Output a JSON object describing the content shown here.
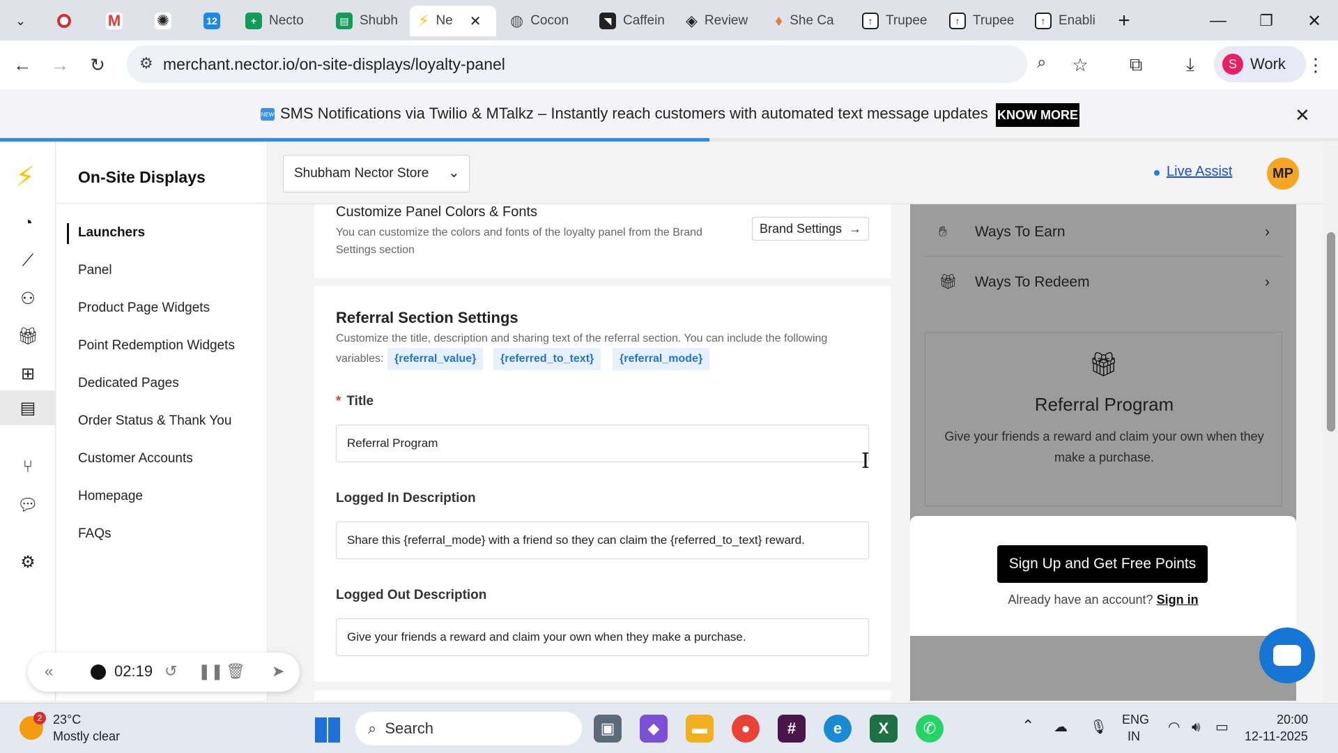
{
  "browser": {
    "tabs": [
      {
        "label": "",
        "icon": "chevron-down-icon",
        "color": "#dfe3e9"
      },
      {
        "label": "",
        "icon": "record-icon",
        "color": "#d32f2f"
      },
      {
        "label": "",
        "icon": "gmail-icon",
        "color": "#e53935"
      },
      {
        "label": "",
        "icon": "openai-icon",
        "color": "#222222"
      },
      {
        "label": "",
        "icon": "calendar-icon",
        "color": "#1e88e5"
      },
      {
        "label": "Necto",
        "icon": "sheets-icon",
        "color": "#0f9d58"
      },
      {
        "label": "Shubh",
        "icon": "sheets-icon",
        "color": "#0f9d58"
      },
      {
        "label": "Ne",
        "icon": "nector-icon",
        "color": "#ffc400",
        "active": true
      },
      {
        "label": "Cocon",
        "icon": "globe-icon",
        "color": "#555555"
      },
      {
        "label": "Caffein",
        "icon": "caffeine-icon",
        "color": "#222222"
      },
      {
        "label": "Review",
        "icon": "review-icon",
        "color": "#222222"
      },
      {
        "label": "She Ca",
        "icon": "drop-icon",
        "color": "#e57c3a"
      },
      {
        "label": "Trupee",
        "icon": "trupee-icon",
        "color": "#222222"
      },
      {
        "label": "Trupee",
        "icon": "trupee-icon",
        "color": "#222222"
      },
      {
        "label": "Enabli",
        "icon": "trupee-icon",
        "color": "#222222"
      }
    ],
    "url": "merchant.nector.io/on-site-displays/loyalty-panel",
    "profile_label": "Work",
    "profile_initial": "S"
  },
  "banner": {
    "text": "SMS Notifications via Twilio & MTalkz – Instantly reach customers with automated text message updates",
    "button": "KNOW MORE",
    "icon_text": "NEW",
    "progress": 0.53
  },
  "sidebar": {
    "title": "On-Site Displays",
    "items": [
      "Launchers",
      "Panel",
      "Product Page Widgets",
      "Point Redemption Widgets",
      "Dedicated Pages",
      "Order Status & Thank You",
      "Customer Accounts",
      "Homepage",
      "FAQs"
    ]
  },
  "recorder": {
    "time": "02:19"
  },
  "header": {
    "store": "Shubham Nector Store",
    "live_assist": "Live Assist",
    "avatar": "MP"
  },
  "colors_card": {
    "title": "Customize Panel Colors & Fonts",
    "desc": "You can customize the colors and fonts of the loyalty panel from the Brand Settings section",
    "button": "Brand Settings"
  },
  "referral": {
    "title": "Referral Section Settings",
    "desc": "Customize the title, description and sharing text of the referral section. You can include the following",
    "variables_label": "variables:",
    "variables": [
      "{referral_value}",
      "{referred_to_text}",
      "{referral_mode}"
    ],
    "title_label": "Title",
    "title_value": "Referral Program",
    "logged_in_label": "Logged In Description",
    "logged_in_value": "Share this {referral_mode} with a friend so they can claim the {referred_to_text} reward.",
    "logged_out_label": "Logged Out Description",
    "logged_out_value": "Give your friends a reward and claim your own when they make a purchase."
  },
  "preview": {
    "rows": [
      "Ways To Earn",
      "Ways To Redeem"
    ],
    "card_title": "Referral Program",
    "card_desc": "Give your friends a reward and claim your own when they make a purchase.",
    "signup_button": "Sign Up and Get Free Points",
    "already_text": "Already have an account?",
    "sign_in": "Sign in"
  },
  "taskbar": {
    "weather_badge": "2",
    "temperature": "23°C",
    "weather": "Mostly clear",
    "search": "Search",
    "lang_top": "ENG",
    "lang_bottom": "IN",
    "time": "20:00",
    "date": "12-11-2025"
  }
}
